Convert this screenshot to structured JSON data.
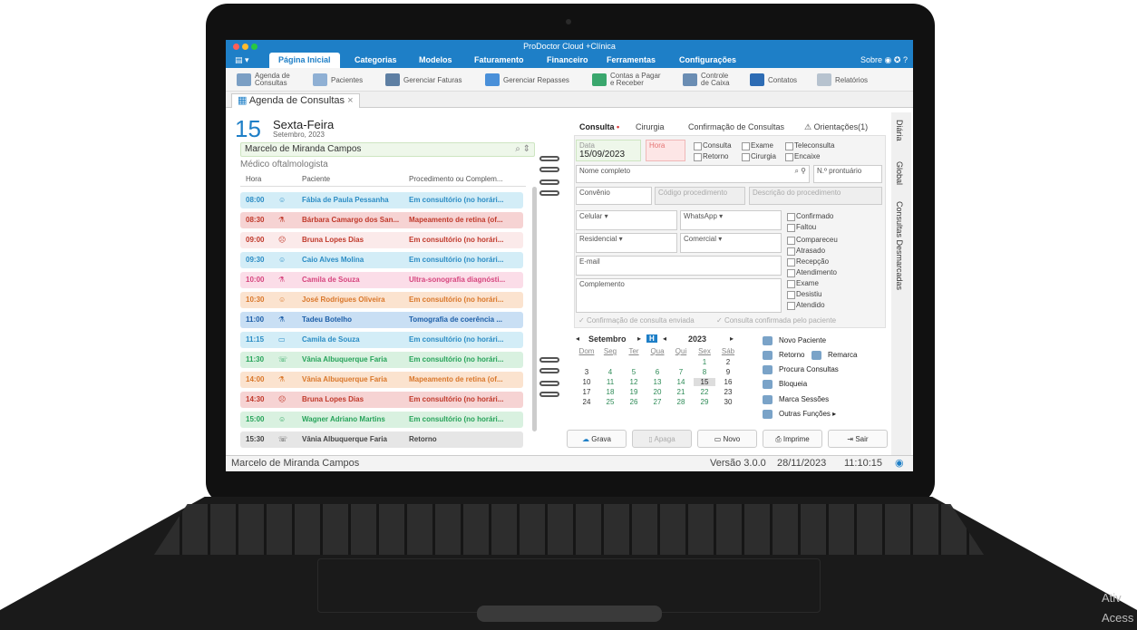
{
  "window": {
    "title": "ProDoctor Cloud +Clínica"
  },
  "menu": {
    "items": [
      "Página Inicial",
      "Categorias",
      "Modelos",
      "Faturamento",
      "Financeiro",
      "Ferramentas",
      "Configurações"
    ],
    "right_label": "Sobre"
  },
  "ribbon": {
    "agenda": "Agenda de\nConsultas",
    "pacientes": "Pacientes",
    "faturas": "Gerenciar Faturas",
    "repasses": "Gerenciar Repasses",
    "contas": "Contas a Pagar\ne Receber",
    "caixa": "Controle\nde Caixa",
    "contatos": "Contatos",
    "relatorios": "Relatórios"
  },
  "doc_tab": {
    "label": "Agenda de Consultas",
    "close": "×"
  },
  "date": {
    "day": "15",
    "weekday": "Sexta-Feira",
    "month_year": "Setembro, 2023"
  },
  "doctor": {
    "name": "Marcelo de Miranda Campos",
    "specialty": "Médico oftalmologista"
  },
  "columns": {
    "hora": "Hora",
    "paciente": "Paciente",
    "procedimento": "Procedimento ou Complem..."
  },
  "appointments": [
    {
      "hora": "08:00",
      "paciente": "Fábia de Paula Pessanha",
      "proc": "Em consultório (no horári...",
      "color": "#d3edf7",
      "text": "#2b8cc4",
      "icon": "smile"
    },
    {
      "hora": "08:30",
      "paciente": "Bárbara Camargo dos San...",
      "proc": "Mapeamento de retina (of...",
      "color": "#f6d3d3",
      "text": "#c0392b",
      "icon": "flask"
    },
    {
      "hora": "09:00",
      "paciente": "Bruna Lopes Dias",
      "proc": "Em consultório (no horári...",
      "color": "#fbeaea",
      "text": "#c0392b",
      "icon": "sad"
    },
    {
      "hora": "09:30",
      "paciente": "Caio Alves Molina",
      "proc": "Em consultório (no horári...",
      "color": "#d3edf7",
      "text": "#2b8cc4",
      "icon": "smile"
    },
    {
      "hora": "10:00",
      "paciente": "Camila de Souza",
      "proc": "Ultra-sonografia diagnósti...",
      "color": "#fbdde8",
      "text": "#d6457e",
      "icon": "flask"
    },
    {
      "hora": "10:30",
      "paciente": "José Rodrigues Oliveira",
      "proc": "Em consultório (no horári...",
      "color": "#fbe3cf",
      "text": "#d9772b",
      "icon": "smile"
    },
    {
      "hora": "11:00",
      "paciente": "Tadeu Botelho",
      "proc": "Tomografia de coerência ...",
      "color": "#c9dff4",
      "text": "#1e5fa8",
      "icon": "flask"
    },
    {
      "hora": "11:15",
      "paciente": "Camila de Souza",
      "proc": "Em consultório (no horári...",
      "color": "#d3edf7",
      "text": "#2b8cc4",
      "icon": "laptop"
    },
    {
      "hora": "11:30",
      "paciente": "Vânia Albuquerque Faria",
      "proc": "Em consultório (no horári...",
      "color": "#d9f1e0",
      "text": "#27a35a",
      "icon": "chat"
    },
    {
      "hora": "14:00",
      "paciente": "Vânia Albuquerque Faria",
      "proc": "Mapeamento de retina (of...",
      "color": "#fbe3cf",
      "text": "#d9772b",
      "icon": "flask"
    },
    {
      "hora": "14:30",
      "paciente": "Bruna Lopes Dias",
      "proc": "Em consultório (no horári...",
      "color": "#f6d3d3",
      "text": "#c0392b",
      "icon": "sad"
    },
    {
      "hora": "15:00",
      "paciente": "Wagner Adriano Martins",
      "proc": "Em consultório (no horári...",
      "color": "#d9f1e0",
      "text": "#27a35a",
      "icon": "smile"
    },
    {
      "hora": "15:30",
      "paciente": "Vânia Albuquerque Faria",
      "proc": "Retorno",
      "color": "#e6e6e6",
      "text": "#444",
      "icon": "chat"
    }
  ],
  "tabs": {
    "consulta": "Consulta",
    "cirurgia": "Cirurgia",
    "confirmacao": "Confirmação de Consultas",
    "orientacoes": "Orientações(1)"
  },
  "form": {
    "data_label": "Data",
    "data_value": "15/09/2023",
    "hora_label": "Hora",
    "types": [
      "Consulta",
      "Exame",
      "Teleconsulta",
      "Retorno",
      "Cirurgia",
      "Encaixe"
    ],
    "nome": "Nome completo",
    "prontuario": "N.º prontuário",
    "convenio": "Convênio",
    "codigo": "Código procedimento",
    "descricao": "Descrição do procedimento",
    "celular": "Celular ▾",
    "whatsapp": "WhatsApp ▾",
    "residencial": "Residencial ▾",
    "comercial": "Comercial ▾",
    "email": "E-mail",
    "complemento": "Complemento",
    "status": [
      "Confirmado",
      "Faltou",
      "Compareceu",
      "Atrasado",
      "Recepção",
      "Atendimento",
      "Exame",
      "Desistiu",
      "Atendido"
    ],
    "conf_enviada": "Confirmação de consulta enviada",
    "conf_paciente": "Consulta confirmada pelo paciente"
  },
  "calendar": {
    "month": "Setembro",
    "year": "2023",
    "today_btn": "H",
    "weekdays": [
      "Dom",
      "Seg",
      "Ter",
      "Qua",
      "Qui",
      "Sex",
      "Sáb"
    ],
    "weeks": [
      [
        "",
        "",
        "",
        "",
        "",
        "1",
        "2"
      ],
      [
        "3",
        "4",
        "5",
        "6",
        "7",
        "8",
        "9"
      ],
      [
        "10",
        "11",
        "12",
        "13",
        "14",
        "15",
        "16"
      ],
      [
        "17",
        "18",
        "19",
        "20",
        "21",
        "22",
        "23"
      ],
      [
        "24",
        "25",
        "26",
        "27",
        "28",
        "29",
        "30"
      ]
    ]
  },
  "actions": [
    "Novo Paciente",
    "Retorno",
    "Remarca",
    "Procura Consultas",
    "Bloqueia",
    "Marca Sessões",
    "Outras Funções ▸"
  ],
  "buttons": {
    "grava": "Grava",
    "apaga": "Apaga",
    "novo": "Novo",
    "imprime": "Imprime",
    "sair": "Sair"
  },
  "side_tabs": [
    "Diária",
    "Global",
    "Consultas Desmarcadas"
  ],
  "status": {
    "user": "Marcelo de Miranda Campos",
    "versao": "Versão 3.0.0",
    "data": "28/11/2023",
    "hora": "11:10:15"
  },
  "watermark": [
    "Ativ",
    "Acess"
  ]
}
